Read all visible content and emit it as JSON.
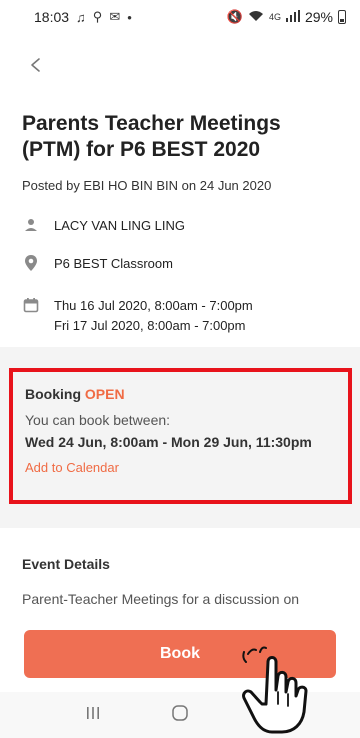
{
  "status_bar": {
    "time": "18:03",
    "battery_percent": "29%",
    "network_label": "4G"
  },
  "event": {
    "title": "Parents Teacher Meetings (PTM) for P6 BEST 2020",
    "posted_by": "Posted by EBI HO BIN BIN on 24 Jun 2020",
    "teacher": "LACY VAN LING LING",
    "location": "P6 BEST Classroom",
    "dates": [
      "Thu 16 Jul 2020, 8:00am - 7:00pm",
      "Fri 17 Jul 2020, 8:00am - 7:00pm"
    ]
  },
  "booking": {
    "label": "Booking",
    "status": "OPEN",
    "between_text": "You can book between:",
    "range": "Wed 24 Jun, 8:00am - Mon 29 Jun, 11:30pm",
    "add_calendar": "Add to Calendar"
  },
  "details": {
    "heading": "Event Details",
    "description": "Parent-Teacher Meetings for a discussion on"
  },
  "actions": {
    "book_label": "Book"
  },
  "colors": {
    "accent": "#ef6f53",
    "highlight_border": "#e8131b",
    "status_open": "#f06b44"
  },
  "icons": {
    "back": "chevron-left-icon",
    "teacher": "person-icon",
    "location": "pin-icon",
    "date": "calendar-icon",
    "pointer": "hand-pointer-icon"
  }
}
